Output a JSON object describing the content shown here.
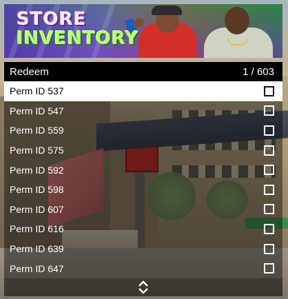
{
  "banner": {
    "title_line1": "STORE",
    "title_line2": "INVENTORY"
  },
  "header": {
    "title": "Redeem",
    "counter": "1 / 603"
  },
  "items": [
    {
      "label": "Perm ID 537",
      "selected": true
    },
    {
      "label": "Perm ID 547",
      "selected": false
    },
    {
      "label": "Perm ID 559",
      "selected": false
    },
    {
      "label": "Perm ID 575",
      "selected": false
    },
    {
      "label": "Perm ID 592",
      "selected": false
    },
    {
      "label": "Perm ID 598",
      "selected": false
    },
    {
      "label": "Perm ID 607",
      "selected": false
    },
    {
      "label": "Perm ID 616",
      "selected": false
    },
    {
      "label": "Perm ID 639",
      "selected": false
    },
    {
      "label": "Perm ID 647",
      "selected": false
    }
  ],
  "footer": {
    "icon": "up-down-arrows-icon"
  },
  "colors": {
    "header_bg": "#000000",
    "selected_row_bg": "#ffffff",
    "row_bg": "rgba(0,0,0,0.42)"
  }
}
